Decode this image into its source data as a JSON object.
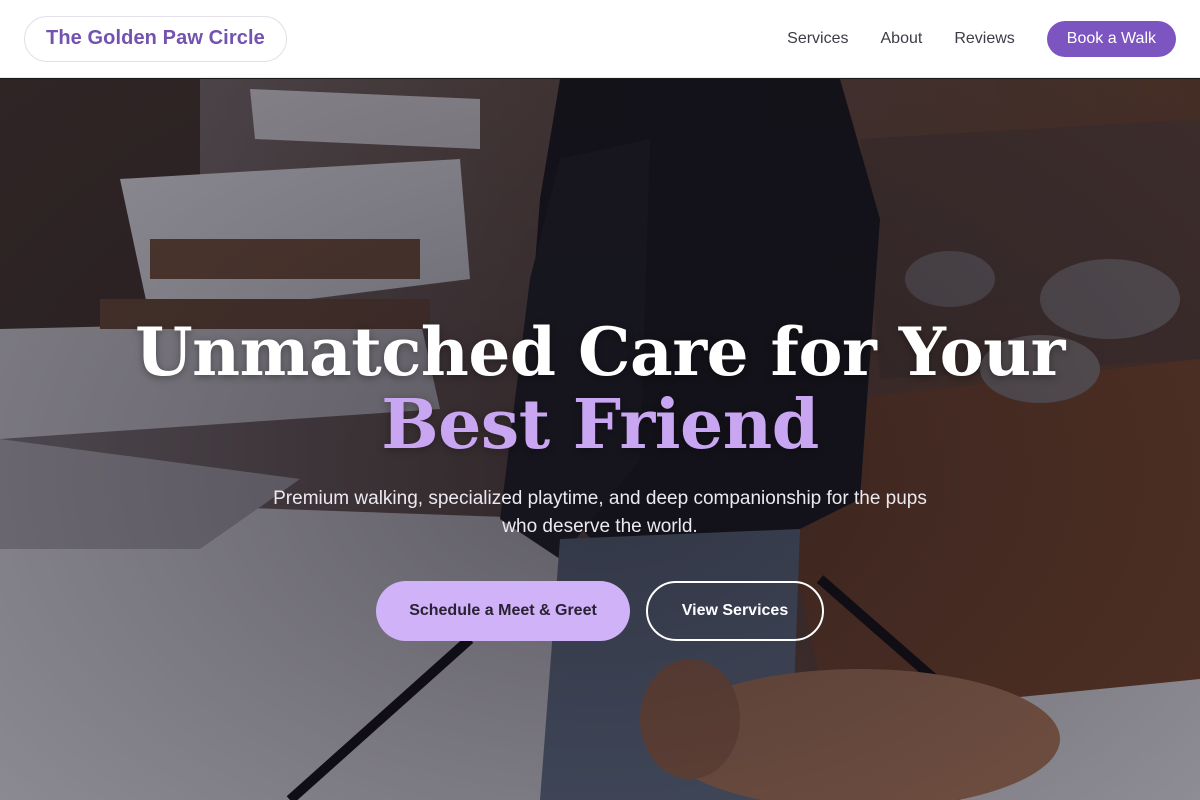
{
  "brand": {
    "name": "The Golden Paw Circle",
    "accent": "#7d55c0",
    "accent_light": "#cfb2f8",
    "headline_accent": "#c9a6f2"
  },
  "nav": {
    "links": [
      "Services",
      "About",
      "Reviews"
    ],
    "cta_label": "Book a Walk"
  },
  "hero": {
    "headline": "Unmatched Care for Your",
    "headline_accent": "Best Friend",
    "subtitle": "Premium walking, specialized playtime, and deep companionship for the pups who deserve the world.",
    "primary_button": "Schedule a Meet & Greet",
    "secondary_button": "View Services",
    "background_icon": "person-walking-dog-in-snow-photo"
  }
}
